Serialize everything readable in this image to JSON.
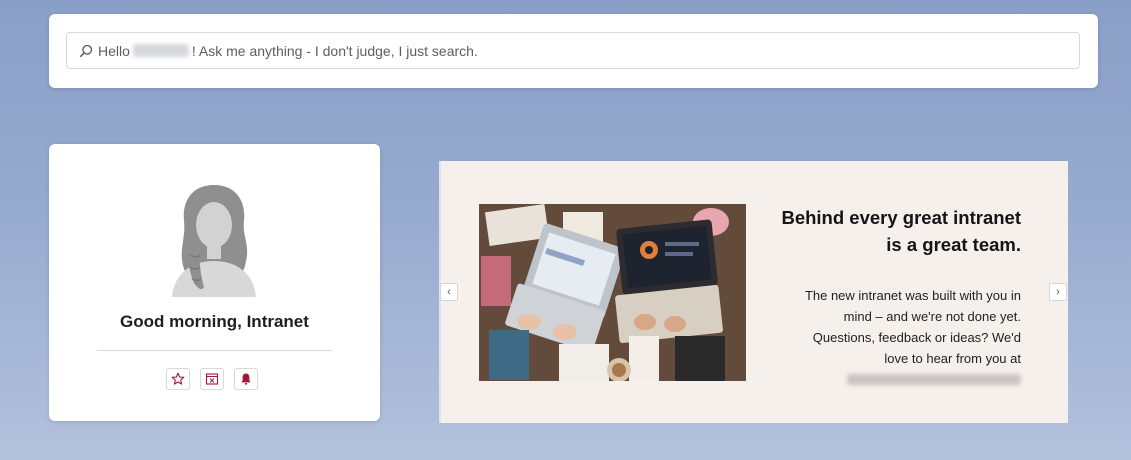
{
  "search": {
    "prefix": "Hello",
    "suffix": "! Ask me anything - I don't judge, I just search.",
    "icon": "search-icon"
  },
  "profile": {
    "greeting": "Good morning, Intranet",
    "actions": [
      {
        "icon": "star-icon"
      },
      {
        "icon": "calendar-icon"
      },
      {
        "icon": "bell-icon"
      }
    ]
  },
  "carousel": {
    "headline_line1": "Behind every great intranet",
    "headline_line2": "is a great team.",
    "body_lines": [
      "The new intranet was built with you in",
      "mind – and we're not done yet.",
      "Questions, feedback or ideas? We'd",
      "love to hear from you at"
    ],
    "prev_label": "‹",
    "next_label": "›"
  },
  "colors": {
    "accent": "#a3163b",
    "carousel_bg": "#f6f0ec"
  }
}
